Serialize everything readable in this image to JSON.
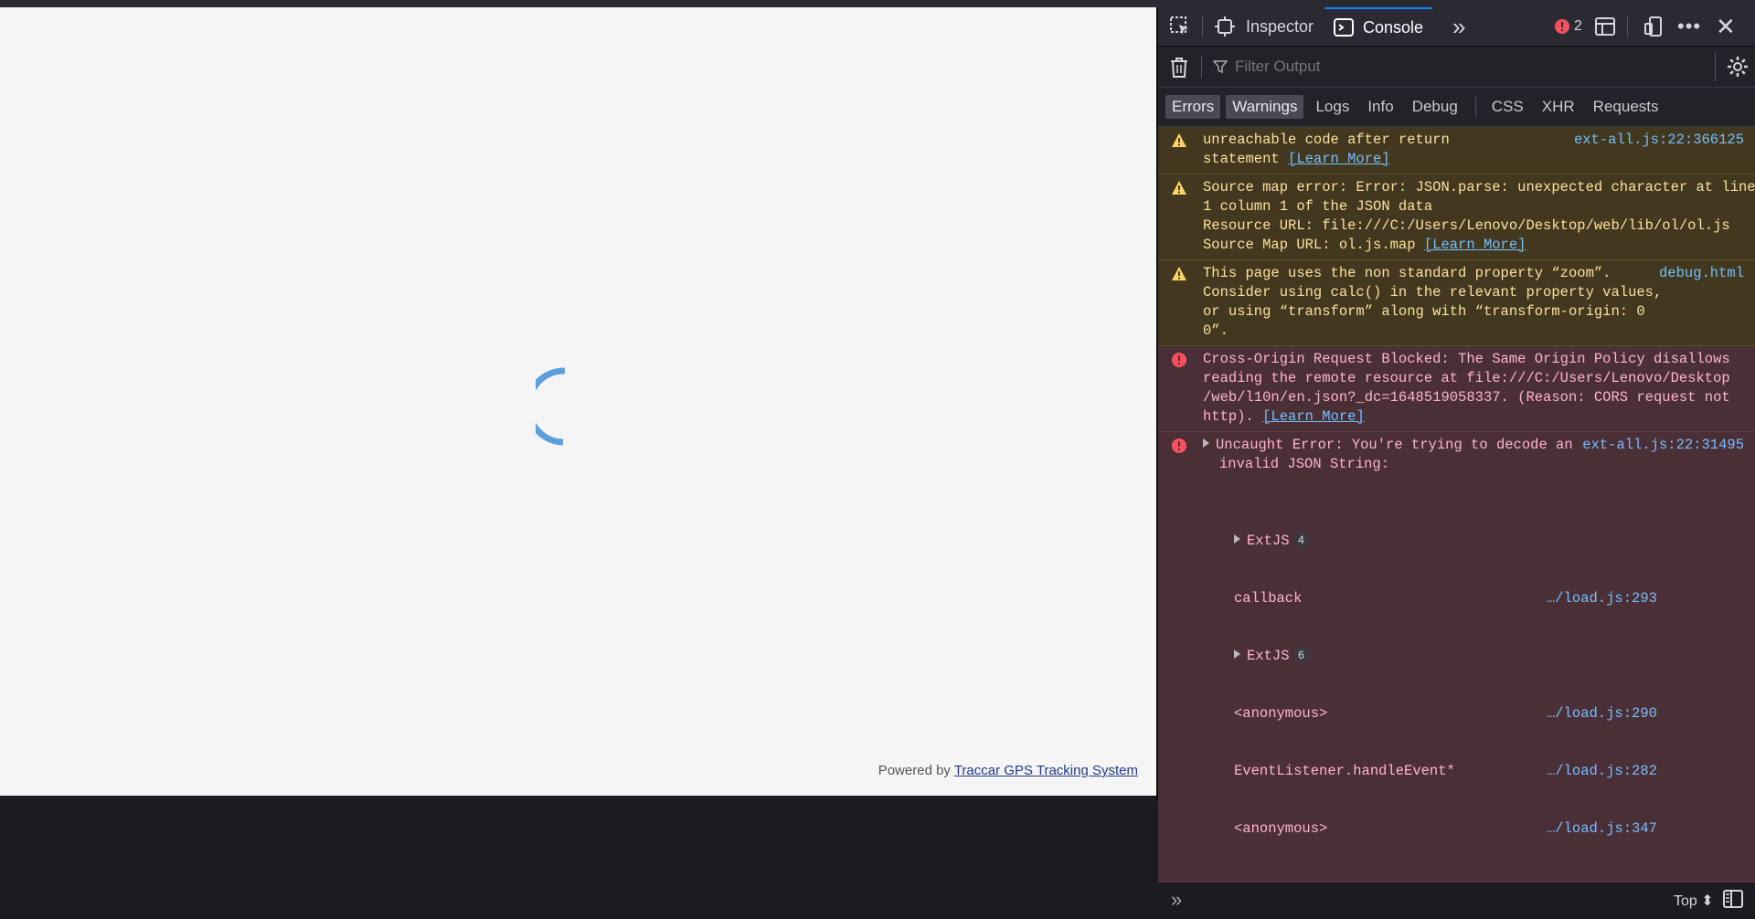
{
  "page": {
    "footer_prefix": "Powered by",
    "footer_link": "Traccar GPS Tracking System"
  },
  "devtools": {
    "tabs": {
      "inspector": "Inspector",
      "console": "Console"
    },
    "error_count": "2",
    "filter_placeholder": "Filter Output",
    "filters": [
      "Errors",
      "Warnings",
      "Logs",
      "Info",
      "Debug",
      "CSS",
      "XHR",
      "Requests"
    ],
    "messages": [
      {
        "level": "warning",
        "text_lines": [
          "unreachable code after return",
          "statement "
        ],
        "learn_more": "[Learn More]",
        "source": "ext-all.js:22:366125"
      },
      {
        "level": "warning",
        "text_lines": [
          "Source map error: Error: JSON.parse: unexpected character at line",
          "1 column 1 of the JSON data",
          "Resource URL: file:///C:/Users/Lenovo/Desktop/web/lib/ol/ol.js",
          "Source Map URL: ol.js.map "
        ],
        "learn_more": "[Learn More]",
        "source": ""
      },
      {
        "level": "warning",
        "text_lines": [
          "This page uses the non standard property “zoom”.",
          "Consider using calc() in the relevant property values,",
          "or using “transform” along with “transform-origin: 0",
          "0”."
        ],
        "learn_more": "",
        "source": "debug.html"
      },
      {
        "level": "error",
        "text_lines": [
          "Cross-Origin Request Blocked: The Same Origin Policy disallows",
          "reading the remote resource at file:///C:/Users/Lenovo/Desktop",
          "/web/l10n/en.json?_dc=1648519058337. (Reason: CORS request not",
          "http). "
        ],
        "learn_more": "[Learn More]",
        "source": ""
      },
      {
        "level": "error",
        "text_lines": [
          "Uncaught Error: You're trying to decode an",
          "invalid JSON String:"
        ],
        "learn_more": "",
        "source": "ext-all.js:22:31495"
      }
    ],
    "stack": [
      {
        "fn": "ExtJS",
        "count": "4",
        "src": ""
      },
      {
        "fn": "callback",
        "count": "",
        "src": "…/load.js:293"
      },
      {
        "fn": "ExtJS",
        "count": "6",
        "src": ""
      },
      {
        "fn": "<anonymous>",
        "count": "",
        "src": "…/load.js:290"
      },
      {
        "fn": "EventListener.handleEvent*",
        "count": "",
        "src": "…/load.js:282"
      },
      {
        "fn": "<anonymous>",
        "count": "",
        "src": "…/load.js:347"
      }
    ],
    "context_selector": "Top",
    "colors": {
      "accent": "#0a84ff",
      "warning_bg": "#42381f",
      "error_bg": "#4b2f36",
      "link": "#75bfff"
    }
  }
}
